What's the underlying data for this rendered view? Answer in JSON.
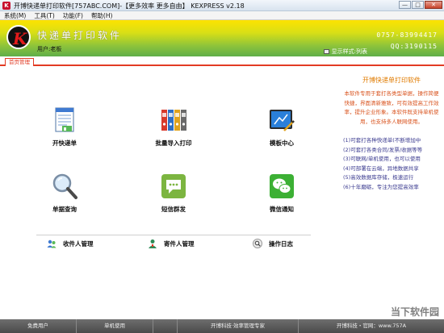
{
  "window": {
    "title": "开博快递单打印软件[757ABC.COM]-【更多效率 更多自由】  KEXPRESS v2.18",
    "minimize": "—",
    "maximize": "□",
    "close": "✕"
  },
  "menu": [
    "系统(M)",
    "工具(T)",
    "功能(F)",
    "帮助(H)"
  ],
  "header": {
    "logo_letter": "K",
    "brand": "快递单打印软件",
    "user_label": "用户:老板",
    "display_mode": "显示样式:列表",
    "phone": "0757-83994417",
    "qq": "QQ:3190115"
  },
  "tabs": [
    "首页管理"
  ],
  "tiles": [
    {
      "label": "开快递单",
      "icon": "document-icon"
    },
    {
      "label": "批量导入打印",
      "icon": "binders-icon"
    },
    {
      "label": "模板中心",
      "icon": "tablet-pen-icon"
    },
    {
      "label": "单据查询",
      "icon": "magnifier-icon"
    },
    {
      "label": "短信群发",
      "icon": "sms-icon"
    },
    {
      "label": "微信通知",
      "icon": "wechat-icon"
    }
  ],
  "bottom_links": [
    {
      "label": "收件人管理",
      "icon": "recipients-icon"
    },
    {
      "label": "寄件人管理",
      "icon": "sender-icon"
    },
    {
      "label": "操作日志",
      "icon": "log-search-icon"
    }
  ],
  "right_panel": {
    "title": "开博快递单打印软件",
    "description": "本软件专用于套打各类型单据，操作简便快捷，界面清新雅致，可有效提高工作效率，提升企业形象。本软件既支持单机使用，也支持多人联网使用。",
    "features": [
      "(1)可套打各种快递单(不断增加中",
      "(2)可套打各类合同/发票/收据等等",
      "(3)可联网/单机使用，也可以使用",
      "(4)可部署在云端，异地数据共享",
      "(5)高效数据库存储，极速运行",
      "(6)十年磨砺，专注为您提高效率"
    ]
  },
  "status_bar": [
    "免费用户",
    "单机使用",
    "",
    "开博科技·效率管理专家",
    "开博科技・官网：www.757A"
  ],
  "watermark": "当下软件园",
  "colors": {
    "accent_red": "#e23b24",
    "header_top": "#fde300",
    "header_bottom": "#5fae49",
    "panel_orange": "#d9531e",
    "panel_blue": "#3a3a8f"
  }
}
